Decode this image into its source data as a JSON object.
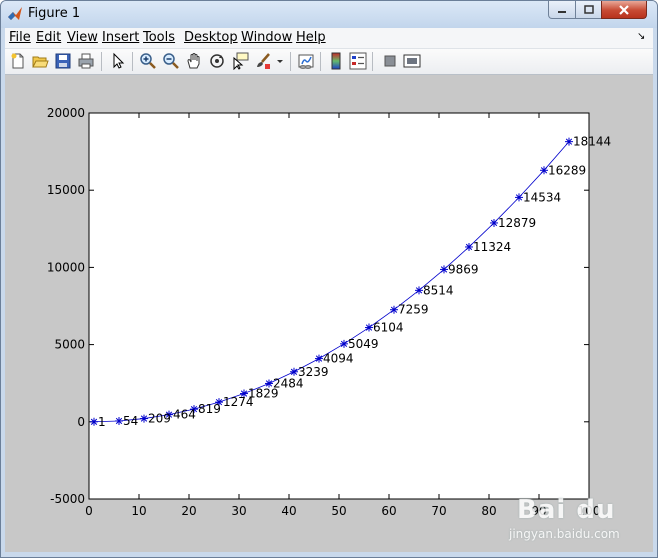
{
  "window": {
    "title": "Figure 1",
    "accent_color": "#c9d9ec"
  },
  "menu": {
    "items": [
      {
        "id": "file",
        "label": "File"
      },
      {
        "id": "edit",
        "label": "Edit"
      },
      {
        "id": "view",
        "label": "View"
      },
      {
        "id": "insert",
        "label": "Insert"
      },
      {
        "id": "tools",
        "label": "Tools"
      },
      {
        "id": "desktop",
        "label": "Desktop"
      },
      {
        "id": "window",
        "label": "Window"
      },
      {
        "id": "help",
        "label": "Help"
      }
    ]
  },
  "toolbar": {
    "icons": [
      "new-figure-icon",
      "open-file-icon",
      "save-icon",
      "print-icon",
      "edit-plot-icon",
      "zoom-in-icon",
      "zoom-out-icon",
      "pan-icon",
      "rotate-3d-icon",
      "data-cursor-icon",
      "brush-icon",
      "brush-dropdown-icon",
      "link-plot-icon",
      "colorbar-icon",
      "legend-icon",
      "hide-plot-tools-icon",
      "show-plot-tools-icon"
    ]
  },
  "watermark": {
    "text": "Bai du",
    "subtext": "jingyan.baidu.com"
  },
  "chart_data": {
    "type": "line",
    "marker": "asterisk",
    "line_color": "#0000cc",
    "x": [
      1,
      6,
      11,
      16,
      21,
      26,
      31,
      36,
      41,
      46,
      51,
      56,
      61,
      66,
      71,
      76,
      81,
      86,
      91,
      96
    ],
    "y": [
      1,
      54,
      209,
      464,
      819,
      1274,
      1829,
      2484,
      3239,
      4094,
      5049,
      6104,
      7259,
      8514,
      9869,
      11324,
      12879,
      14534,
      16289,
      18144
    ],
    "point_labels": [
      "1",
      "54",
      "209",
      "464",
      "819",
      "1274",
      "1829",
      "2484",
      "3239",
      "4094",
      "5049",
      "6104",
      "7259",
      "8514",
      "9869",
      "11324",
      "12879",
      "14534",
      "16289",
      "18144"
    ],
    "xlim": [
      0,
      100
    ],
    "ylim": [
      -5000,
      20000
    ],
    "xticks": [
      0,
      10,
      20,
      30,
      40,
      50,
      60,
      70,
      80,
      90,
      100
    ],
    "yticks": [
      -5000,
      0,
      5000,
      10000,
      15000,
      20000
    ],
    "grid": false
  }
}
